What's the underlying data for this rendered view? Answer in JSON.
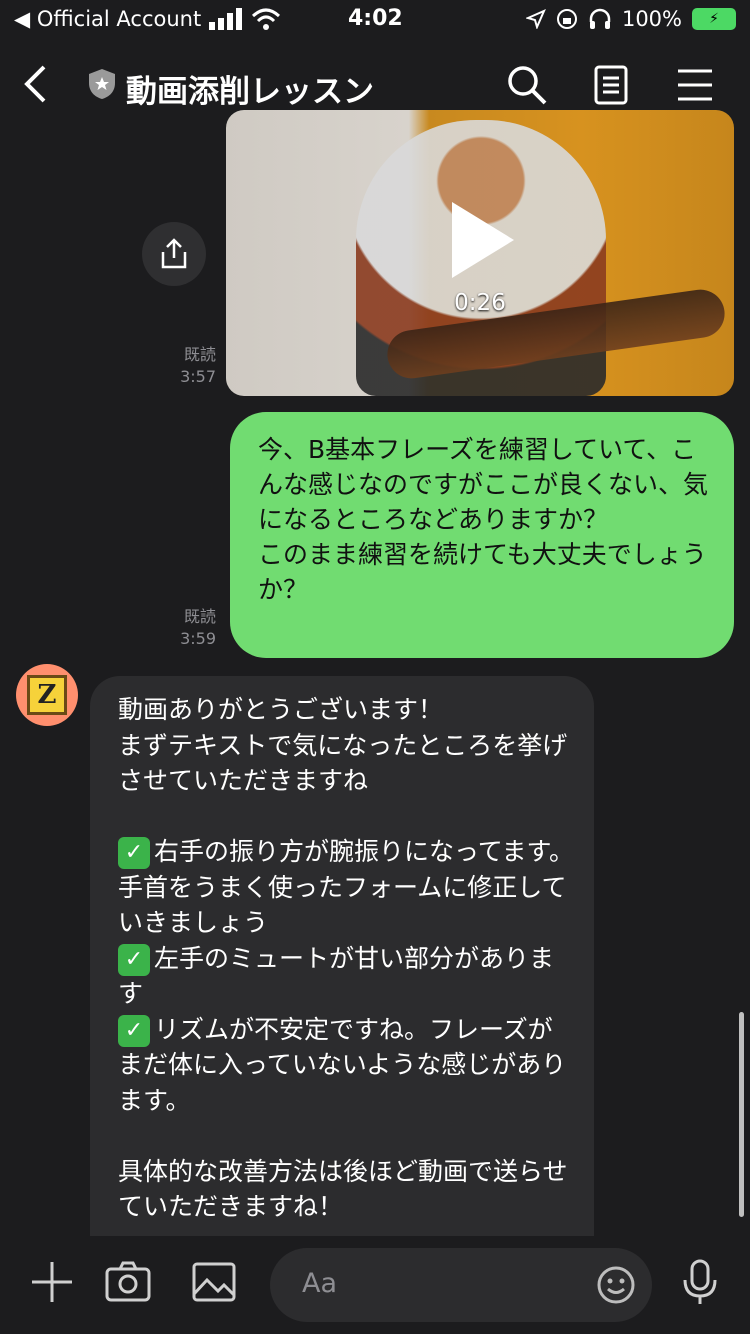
{
  "status_bar": {
    "back_app": "◀ Official Account",
    "time": "4:02",
    "battery": "100%"
  },
  "header": {
    "title": "動画添削レッスン"
  },
  "messages": {
    "video": {
      "duration": "0:26"
    },
    "read_label": "既読",
    "video_read_time": "3:57",
    "outgoing_text": "今、B基本フレーズを練習していて、こんな感じなのですがここが良くない、気になるところなどありますか？\nこのまま練習を続けても大丈夫でしょうか？",
    "outgoing_read_time": "3:59",
    "incoming": {
      "intro": "動画ありがとうございます！\nまずテキストで気になったところを挙げさせていただきますね\n\n",
      "point1": "右手の振り方が腕振りになってます。手首をうまく使ったフォームに修正していきましょう\n",
      "point2": "左手のミュートが甘い部分があります\n",
      "point3": "リズムが不安定ですね。フレーズがまだ体に入っていないような感じがあります。\n\n",
      "outro": "具体的な改善方法は後ほど動画で送らせていただきますね！"
    }
  },
  "composer": {
    "placeholder": "Aa"
  },
  "colors": {
    "background": "#1c1c1e",
    "outgoing_bubble": "#71dc71",
    "incoming_bubble": "#2c2c2e"
  }
}
